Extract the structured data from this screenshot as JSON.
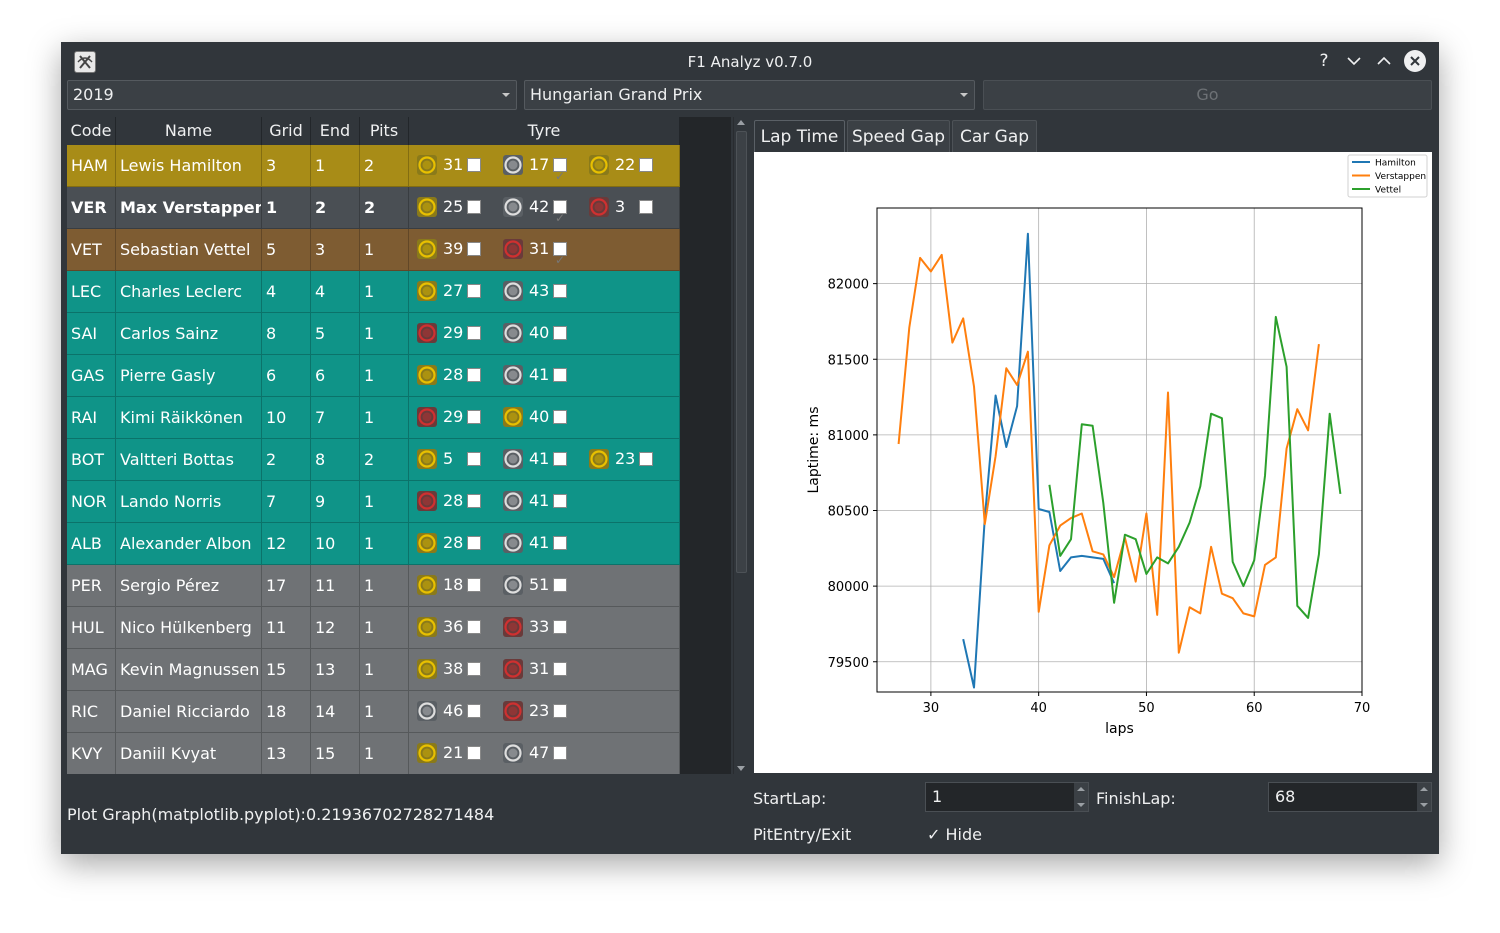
{
  "window": {
    "title": "F1 Analyz v0.7.0"
  },
  "controls": {
    "year": "2019",
    "race": "Hungarian Grand Prix",
    "go_label": "Go"
  },
  "table": {
    "headers": [
      "Code",
      "Name",
      "Grid",
      "End",
      "Pits",
      "Tyre"
    ],
    "rows": [
      {
        "code": "HAM",
        "name": "Lewis Hamilton",
        "grid": "3",
        "end": "1",
        "pits": "2",
        "bg": "#a88c17",
        "bold": false,
        "tyres": [
          {
            "c": "M",
            "lap": "31",
            "chk": false
          },
          {
            "c": "H",
            "lap": "17",
            "chk": true
          },
          {
            "c": "M",
            "lap": "22",
            "chk": false
          }
        ]
      },
      {
        "code": "VER",
        "name": "Max Verstappen",
        "grid": "1",
        "end": "2",
        "pits": "2",
        "bg": "#4a4f54",
        "bold": true,
        "tyres": [
          {
            "c": "M",
            "lap": "25",
            "chk": false
          },
          {
            "c": "H",
            "lap": "42",
            "chk": true
          },
          {
            "c": "S",
            "lap": "3",
            "chk": false
          }
        ]
      },
      {
        "code": "VET",
        "name": "Sebastian Vettel",
        "grid": "5",
        "end": "3",
        "pits": "1",
        "bg": "#7e5c32",
        "bold": false,
        "tyres": [
          {
            "c": "M",
            "lap": "39",
            "chk": false
          },
          {
            "c": "S",
            "lap": "31",
            "chk": true
          }
        ]
      },
      {
        "code": "LEC",
        "name": "Charles Leclerc",
        "grid": "4",
        "end": "4",
        "pits": "1",
        "bg": "#0f9488",
        "bold": false,
        "tyres": [
          {
            "c": "M",
            "lap": "27",
            "chk": false
          },
          {
            "c": "H",
            "lap": "43",
            "chk": false
          }
        ]
      },
      {
        "code": "SAI",
        "name": "Carlos Sainz",
        "grid": "8",
        "end": "5",
        "pits": "1",
        "bg": "#0f9488",
        "bold": false,
        "tyres": [
          {
            "c": "S",
            "lap": "29",
            "chk": false
          },
          {
            "c": "H",
            "lap": "40",
            "chk": false
          }
        ]
      },
      {
        "code": "GAS",
        "name": "Pierre Gasly",
        "grid": "6",
        "end": "6",
        "pits": "1",
        "bg": "#0f9488",
        "bold": false,
        "tyres": [
          {
            "c": "M",
            "lap": "28",
            "chk": false
          },
          {
            "c": "H",
            "lap": "41",
            "chk": false
          }
        ]
      },
      {
        "code": "RAI",
        "name": "Kimi Räikkönen",
        "grid": "10",
        "end": "7",
        "pits": "1",
        "bg": "#0f9488",
        "bold": false,
        "tyres": [
          {
            "c": "S",
            "lap": "29",
            "chk": false
          },
          {
            "c": "M",
            "lap": "40",
            "chk": false
          }
        ]
      },
      {
        "code": "BOT",
        "name": "Valtteri Bottas",
        "grid": "2",
        "end": "8",
        "pits": "2",
        "bg": "#0f9488",
        "bold": false,
        "tyres": [
          {
            "c": "M",
            "lap": "5",
            "chk": false
          },
          {
            "c": "H",
            "lap": "41",
            "chk": false
          },
          {
            "c": "M",
            "lap": "23",
            "chk": false
          }
        ]
      },
      {
        "code": "NOR",
        "name": "Lando Norris",
        "grid": "7",
        "end": "9",
        "pits": "1",
        "bg": "#0f9488",
        "bold": false,
        "tyres": [
          {
            "c": "S",
            "lap": "28",
            "chk": false
          },
          {
            "c": "H",
            "lap": "41",
            "chk": false
          }
        ]
      },
      {
        "code": "ALB",
        "name": "Alexander Albon",
        "grid": "12",
        "end": "10",
        "pits": "1",
        "bg": "#0f9488",
        "bold": false,
        "tyres": [
          {
            "c": "M",
            "lap": "28",
            "chk": false
          },
          {
            "c": "H",
            "lap": "41",
            "chk": false
          }
        ]
      },
      {
        "code": "PER",
        "name": "Sergio Pérez",
        "grid": "17",
        "end": "11",
        "pits": "1",
        "bg": "#6f7275",
        "bold": false,
        "tyres": [
          {
            "c": "M",
            "lap": "18",
            "chk": false
          },
          {
            "c": "H",
            "lap": "51",
            "chk": false
          }
        ]
      },
      {
        "code": "HUL",
        "name": "Nico Hülkenberg",
        "grid": "11",
        "end": "12",
        "pits": "1",
        "bg": "#6f7275",
        "bold": false,
        "tyres": [
          {
            "c": "M",
            "lap": "36",
            "chk": false
          },
          {
            "c": "S",
            "lap": "33",
            "chk": false
          }
        ]
      },
      {
        "code": "MAG",
        "name": "Kevin Magnussen",
        "grid": "15",
        "end": "13",
        "pits": "1",
        "bg": "#6f7275",
        "bold": false,
        "tyres": [
          {
            "c": "M",
            "lap": "38",
            "chk": false
          },
          {
            "c": "S",
            "lap": "31",
            "chk": false
          }
        ]
      },
      {
        "code": "RIC",
        "name": "Daniel Ricciardo",
        "grid": "18",
        "end": "14",
        "pits": "1",
        "bg": "#6f7275",
        "bold": false,
        "tyres": [
          {
            "c": "H",
            "lap": "46",
            "chk": false
          },
          {
            "c": "S",
            "lap": "23",
            "chk": false
          }
        ]
      },
      {
        "code": "KVY",
        "name": "Daniil Kvyat",
        "grid": "13",
        "end": "15",
        "pits": "1",
        "bg": "#6f7275",
        "bold": false,
        "tyres": [
          {
            "c": "M",
            "lap": "21",
            "chk": false
          },
          {
            "c": "H",
            "lap": "47",
            "chk": false
          }
        ]
      }
    ]
  },
  "tabs": [
    "Lap Time",
    "Speed Gap",
    "Car Gap"
  ],
  "chart_data": {
    "type": "line",
    "xlabel": "laps",
    "ylabel": "Laptime: ms",
    "xlim": [
      25,
      70
    ],
    "ylim": [
      79300,
      82500
    ],
    "xticks": [
      30,
      40,
      50,
      60,
      70
    ],
    "yticks": [
      79500,
      80000,
      80500,
      81000,
      81500,
      82000
    ],
    "grid": true,
    "legend": "top-right",
    "series": [
      {
        "name": "Hamilton",
        "color": "#1f77b4",
        "x": [
          33,
          34,
          35,
          36,
          37,
          38,
          39,
          40,
          41,
          42,
          43,
          44,
          45,
          46,
          47
        ],
        "y": [
          79650,
          79330,
          80450,
          81260,
          80920,
          81190,
          82330,
          80510,
          80490,
          80100,
          80190,
          80200,
          80190,
          80180,
          80020
        ]
      },
      {
        "name": "Verstappen",
        "color": "#ff7f0e",
        "x": [
          27,
          28,
          29,
          30,
          31,
          32,
          33,
          34,
          35,
          36,
          37,
          38,
          39,
          40,
          41,
          42,
          43,
          44,
          45,
          46,
          47,
          48,
          49,
          50,
          51,
          52,
          53,
          54,
          55,
          56,
          57,
          58,
          59,
          60,
          61,
          62,
          63,
          64,
          65,
          66
        ],
        "y": [
          80940,
          81710,
          82170,
          82080,
          82190,
          81610,
          81770,
          81320,
          80410,
          80860,
          81440,
          81330,
          81550,
          79830,
          80270,
          80400,
          80450,
          80480,
          80230,
          80210,
          80060,
          80320,
          80030,
          80480,
          79810,
          81280,
          79560,
          79860,
          79820,
          80260,
          79950,
          79920,
          79820,
          79800,
          80140,
          80190,
          80910,
          81170,
          81030,
          81600
        ]
      },
      {
        "name": "Vettel",
        "color": "#2ca02c",
        "x": [
          41,
          42,
          43,
          44,
          45,
          46,
          47,
          48,
          49,
          50,
          51,
          52,
          53,
          54,
          55,
          56,
          57,
          58,
          59,
          60,
          61,
          62,
          63,
          64,
          65,
          66,
          67,
          68
        ],
        "y": [
          80670,
          80200,
          80310,
          81070,
          81060,
          80550,
          79890,
          80340,
          80310,
          80080,
          80190,
          80150,
          80260,
          80420,
          80660,
          81140,
          81110,
          80160,
          80000,
          80170,
          80730,
          81780,
          81450,
          79870,
          79790,
          80210,
          81140,
          80610
        ]
      }
    ]
  },
  "bottom": {
    "status": "Plot Graph(matplotlib.pyplot):0.21936702728271484",
    "start_label": "StartLap:",
    "start_value": "1",
    "finish_label": "FinishLap:",
    "finish_value": "68",
    "pit_label": "PitEntry/Exit",
    "hide_label": "✓  Hide"
  },
  "colors": {
    "soft": "#d03030",
    "medium": "#e8c000",
    "hard": "#dedede"
  }
}
